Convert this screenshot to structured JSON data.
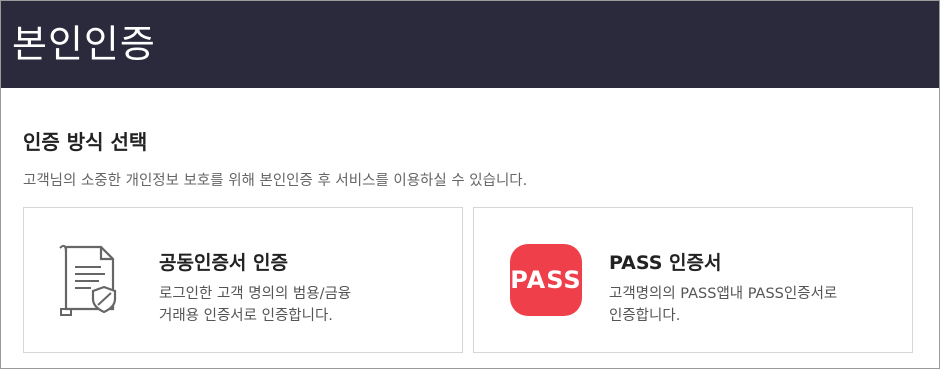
{
  "header": {
    "title": "본인인증"
  },
  "section": {
    "title": "인증 방식 선택",
    "description": "고객님의 소중한 개인정보 보호를 위해 본인인증 후 서비스를 이용하실 수 있습니다."
  },
  "options": [
    {
      "title": "공동인증서 인증",
      "desc_line1": "로그인한 고객 명의의 범용/금융",
      "desc_line2": "거래용 인증서로 인증합니다.",
      "icon": "certificate-document-icon"
    },
    {
      "title": "PASS 인증서",
      "desc_line1": "고객명의의 PASS앱내 PASS인증서로",
      "desc_line2": "인증합니다.",
      "icon": "pass-app-icon",
      "logo_text": "PASS",
      "brand_color": "#ee3f4b"
    }
  ],
  "colors": {
    "header_bg": "#2b2a3d",
    "border": "#d6d6d6"
  }
}
